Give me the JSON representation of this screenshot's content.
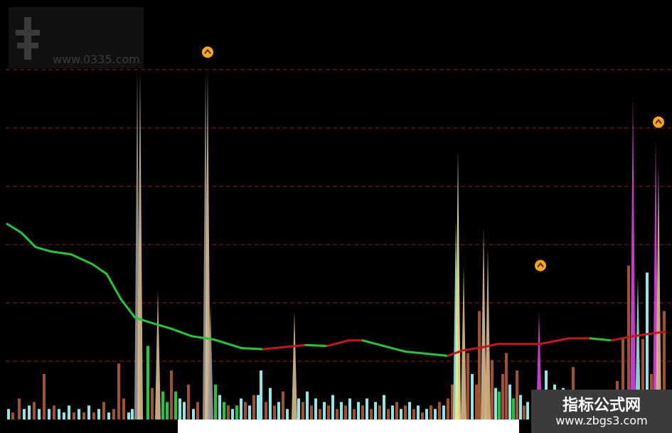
{
  "watermark": {
    "title": "",
    "url": "www.0335.com"
  },
  "brand": {
    "name": "指标公式网",
    "url": "www.zbgs3.com"
  },
  "footer": {
    "text": ""
  },
  "chart_data": {
    "type": "bar",
    "title": "",
    "xlabel": "",
    "ylabel": "",
    "ylim": [
      0,
      100
    ],
    "grid": true,
    "colors": {
      "background": "#000000",
      "grid": "#8b1a1a",
      "line_falling": "#22c83a",
      "line_rising": "#c4161c",
      "arrow": "#f5a623"
    },
    "spikes": [
      {
        "x": 193,
        "value": 100,
        "color": "#9a9a9a"
      },
      {
        "x": 197,
        "value": 100,
        "color": "#d9b98a"
      },
      {
        "x": 222,
        "value": 37,
        "color": "#d9b98a"
      },
      {
        "x": 289,
        "value": 100,
        "color": "#9a9a9a"
      },
      {
        "x": 292,
        "value": 100,
        "color": "#d9b98a"
      },
      {
        "x": 296,
        "value": 33,
        "color": "#9a9a9a"
      },
      {
        "x": 414,
        "value": 31,
        "color": "#d9b98a"
      },
      {
        "x": 641,
        "value": 57,
        "color": "#8fe6e6"
      },
      {
        "x": 644,
        "value": 77,
        "color": "#f0e68c"
      },
      {
        "x": 652,
        "value": 44,
        "color": "#d9b98a"
      },
      {
        "x": 680,
        "value": 55,
        "color": "#d9b98a"
      },
      {
        "x": 686,
        "value": 49,
        "color": "#d9b98a"
      },
      {
        "x": 758,
        "value": 31,
        "color": "#e040e0"
      },
      {
        "x": 890,
        "value": 93,
        "color": "#e040e0"
      },
      {
        "x": 897,
        "value": 41,
        "color": "#8fe6e6"
      },
      {
        "x": 922,
        "value": 80,
        "color": "#e040e0"
      },
      {
        "x": 926,
        "value": 73,
        "color": "#d9b98a"
      }
    ],
    "bars": [
      {
        "x": 12,
        "value": 3,
        "color": "#8fe6e6"
      },
      {
        "x": 18,
        "value": 2,
        "color": "#a0522d"
      },
      {
        "x": 27,
        "value": 6,
        "color": "#a0522d"
      },
      {
        "x": 34,
        "value": 3,
        "color": "#8fe6e6"
      },
      {
        "x": 41,
        "value": 4,
        "color": "#8fe6e6"
      },
      {
        "x": 48,
        "value": 5,
        "color": "#a0522d"
      },
      {
        "x": 55,
        "value": 3,
        "color": "#8fe6e6"
      },
      {
        "x": 62,
        "value": 13,
        "color": "#a0522d"
      },
      {
        "x": 69,
        "value": 3,
        "color": "#8fe6e6"
      },
      {
        "x": 76,
        "value": 4,
        "color": "#a0522d"
      },
      {
        "x": 83,
        "value": 3,
        "color": "#8fe6e6"
      },
      {
        "x": 90,
        "value": 2,
        "color": "#8fe6e6"
      },
      {
        "x": 97,
        "value": 4,
        "color": "#8fe6e6"
      },
      {
        "x": 104,
        "value": 2,
        "color": "#a0522d"
      },
      {
        "x": 111,
        "value": 3,
        "color": "#8fe6e6"
      },
      {
        "x": 118,
        "value": 2,
        "color": "#a0522d"
      },
      {
        "x": 125,
        "value": 4,
        "color": "#8fe6e6"
      },
      {
        "x": 132,
        "value": 2,
        "color": "#a0522d"
      },
      {
        "x": 139,
        "value": 3,
        "color": "#8fe6e6"
      },
      {
        "x": 146,
        "value": 5,
        "color": "#a0522d"
      },
      {
        "x": 153,
        "value": 2,
        "color": "#8fe6e6"
      },
      {
        "x": 160,
        "value": 3,
        "color": "#a0522d"
      },
      {
        "x": 167,
        "value": 16,
        "color": "#a0522d"
      },
      {
        "x": 174,
        "value": 6,
        "color": "#a0522d"
      },
      {
        "x": 181,
        "value": 2,
        "color": "#8fe6e6"
      },
      {
        "x": 186,
        "value": 3,
        "color": "#8fe6e6"
      },
      {
        "x": 208,
        "value": 21,
        "color": "#22c83a"
      },
      {
        "x": 214,
        "value": 9,
        "color": "#a0522d"
      },
      {
        "x": 229,
        "value": 8,
        "color": "#22c83a"
      },
      {
        "x": 235,
        "value": 5,
        "color": "#22c83a"
      },
      {
        "x": 241,
        "value": 14,
        "color": "#a0522d"
      },
      {
        "x": 247,
        "value": 8,
        "color": "#22c83a"
      },
      {
        "x": 253,
        "value": 6,
        "color": "#8fe6e6"
      },
      {
        "x": 259,
        "value": 5,
        "color": "#8fe6e6"
      },
      {
        "x": 265,
        "value": 10,
        "color": "#a0522d"
      },
      {
        "x": 272,
        "value": 3,
        "color": "#8fe6e6"
      },
      {
        "x": 278,
        "value": 5,
        "color": "#a0522d"
      },
      {
        "x": 303,
        "value": 10,
        "color": "#22c83a"
      },
      {
        "x": 309,
        "value": 7,
        "color": "#8fe6e6"
      },
      {
        "x": 315,
        "value": 5,
        "color": "#22c83a"
      },
      {
        "x": 321,
        "value": 4,
        "color": "#a0522d"
      },
      {
        "x": 327,
        "value": 3,
        "color": "#8fe6e6"
      },
      {
        "x": 333,
        "value": 4,
        "color": "#22c83a"
      },
      {
        "x": 339,
        "value": 6,
        "color": "#8fe6e6"
      },
      {
        "x": 345,
        "value": 5,
        "color": "#a0522d"
      },
      {
        "x": 351,
        "value": 4,
        "color": "#8fe6e6"
      },
      {
        "x": 357,
        "value": 7,
        "color": "#a0522d"
      },
      {
        "x": 363,
        "value": 7,
        "color": "#8fe6e6"
      },
      {
        "x": 367,
        "value": 14,
        "color": "#8fe6e6"
      },
      {
        "x": 374,
        "value": 5,
        "color": "#a0522d"
      },
      {
        "x": 380,
        "value": 9,
        "color": "#8fe6e6"
      },
      {
        "x": 386,
        "value": 4,
        "color": "#a0522d"
      },
      {
        "x": 392,
        "value": 5,
        "color": "#8fe6e6"
      },
      {
        "x": 398,
        "value": 8,
        "color": "#a0522d"
      },
      {
        "x": 404,
        "value": 3,
        "color": "#8fe6e6"
      },
      {
        "x": 420,
        "value": 6,
        "color": "#8fe6e6"
      },
      {
        "x": 426,
        "value": 5,
        "color": "#a0522d"
      },
      {
        "x": 432,
        "value": 8,
        "color": "#8fe6e6"
      },
      {
        "x": 438,
        "value": 4,
        "color": "#a0522d"
      },
      {
        "x": 444,
        "value": 6,
        "color": "#8fe6e6"
      },
      {
        "x": 450,
        "value": 3,
        "color": "#a0522d"
      },
      {
        "x": 456,
        "value": 5,
        "color": "#8fe6e6"
      },
      {
        "x": 462,
        "value": 4,
        "color": "#a0522d"
      },
      {
        "x": 468,
        "value": 7,
        "color": "#8fe6e6"
      },
      {
        "x": 474,
        "value": 3,
        "color": "#a0522d"
      },
      {
        "x": 480,
        "value": 5,
        "color": "#8fe6e6"
      },
      {
        "x": 486,
        "value": 4,
        "color": "#a0522d"
      },
      {
        "x": 492,
        "value": 6,
        "color": "#8fe6e6"
      },
      {
        "x": 498,
        "value": 3,
        "color": "#a0522d"
      },
      {
        "x": 504,
        "value": 5,
        "color": "#8fe6e6"
      },
      {
        "x": 510,
        "value": 4,
        "color": "#a0522d"
      },
      {
        "x": 516,
        "value": 6,
        "color": "#8fe6e6"
      },
      {
        "x": 522,
        "value": 3,
        "color": "#a0522d"
      },
      {
        "x": 528,
        "value": 5,
        "color": "#8fe6e6"
      },
      {
        "x": 534,
        "value": 4,
        "color": "#a0522d"
      },
      {
        "x": 540,
        "value": 7,
        "color": "#8fe6e6"
      },
      {
        "x": 546,
        "value": 3,
        "color": "#a0522d"
      },
      {
        "x": 552,
        "value": 4,
        "color": "#8fe6e6"
      },
      {
        "x": 558,
        "value": 5,
        "color": "#a0522d"
      },
      {
        "x": 564,
        "value": 3,
        "color": "#8fe6e6"
      },
      {
        "x": 570,
        "value": 4,
        "color": "#a0522d"
      },
      {
        "x": 576,
        "value": 5,
        "color": "#8fe6e6"
      },
      {
        "x": 582,
        "value": 3,
        "color": "#a0522d"
      },
      {
        "x": 588,
        "value": 4,
        "color": "#8fe6e6"
      },
      {
        "x": 594,
        "value": 2,
        "color": "#a0522d"
      },
      {
        "x": 600,
        "value": 3,
        "color": "#8fe6e6"
      },
      {
        "x": 606,
        "value": 4,
        "color": "#a0522d"
      },
      {
        "x": 612,
        "value": 3,
        "color": "#8fe6e6"
      },
      {
        "x": 618,
        "value": 5,
        "color": "#a0522d"
      },
      {
        "x": 624,
        "value": 4,
        "color": "#8fe6e6"
      },
      {
        "x": 630,
        "value": 6,
        "color": "#a0522d"
      },
      {
        "x": 636,
        "value": 10,
        "color": "#a0522d"
      },
      {
        "x": 658,
        "value": 19,
        "color": "#a0522d"
      },
      {
        "x": 664,
        "value": 13,
        "color": "#8fe6e6"
      },
      {
        "x": 670,
        "value": 10,
        "color": "#a0522d"
      },
      {
        "x": 674,
        "value": 31,
        "color": "#a0522d"
      },
      {
        "x": 692,
        "value": 17,
        "color": "#a0522d"
      },
      {
        "x": 697,
        "value": 9,
        "color": "#8fe6e6"
      },
      {
        "x": 702,
        "value": 8,
        "color": "#22c83a"
      },
      {
        "x": 707,
        "value": 13,
        "color": "#a0522d"
      },
      {
        "x": 712,
        "value": 19,
        "color": "#a0522d"
      },
      {
        "x": 717,
        "value": 10,
        "color": "#8fe6e6"
      },
      {
        "x": 722,
        "value": 6,
        "color": "#22c83a"
      },
      {
        "x": 727,
        "value": 14,
        "color": "#a0522d"
      },
      {
        "x": 732,
        "value": 7,
        "color": "#8fe6e6"
      },
      {
        "x": 737,
        "value": 4,
        "color": "#a0522d"
      },
      {
        "x": 742,
        "value": 5,
        "color": "#8fe6e6"
      },
      {
        "x": 768,
        "value": 14,
        "color": "#8fe6e6"
      },
      {
        "x": 774,
        "value": 8,
        "color": "#a0522d"
      },
      {
        "x": 780,
        "value": 10,
        "color": "#8fe6e6"
      },
      {
        "x": 786,
        "value": 6,
        "color": "#a0522d"
      },
      {
        "x": 792,
        "value": 9,
        "color": "#8fe6e6"
      },
      {
        "x": 806,
        "value": 15,
        "color": "#a0522d"
      },
      {
        "x": 868,
        "value": 11,
        "color": "#a0522d"
      },
      {
        "x": 876,
        "value": 23,
        "color": "#a0522d"
      },
      {
        "x": 884,
        "value": 44,
        "color": "#a0522d"
      },
      {
        "x": 904,
        "value": 23,
        "color": "#a0522d"
      },
      {
        "x": 910,
        "value": 42,
        "color": "#8fe6e6"
      },
      {
        "x": 916,
        "value": 13,
        "color": "#a0522d"
      },
      {
        "x": 934,
        "value": 31,
        "color": "#a0522d"
      }
    ],
    "line": [
      {
        "x": 10,
        "value": 55.9
      },
      {
        "x": 30,
        "value": 53.4
      },
      {
        "x": 50,
        "value": 49.3
      },
      {
        "x": 70,
        "value": 48.1
      },
      {
        "x": 100,
        "value": 47.2
      },
      {
        "x": 130,
        "value": 44.4
      },
      {
        "x": 150,
        "value": 41.6
      },
      {
        "x": 170,
        "value": 34.4
      },
      {
        "x": 190,
        "value": 29.1
      },
      {
        "x": 210,
        "value": 27.8
      },
      {
        "x": 240,
        "value": 26.0
      },
      {
        "x": 270,
        "value": 23.8
      },
      {
        "x": 300,
        "value": 22.9
      },
      {
        "x": 340,
        "value": 20.4
      },
      {
        "x": 370,
        "value": 20.1
      },
      {
        "x": 400,
        "value": 20.7
      },
      {
        "x": 430,
        "value": 21.3
      },
      {
        "x": 460,
        "value": 21.0
      },
      {
        "x": 490,
        "value": 22.6
      },
      {
        "x": 510,
        "value": 22.6
      },
      {
        "x": 540,
        "value": 21.0
      },
      {
        "x": 570,
        "value": 19.4
      },
      {
        "x": 600,
        "value": 18.8
      },
      {
        "x": 630,
        "value": 18.2
      },
      {
        "x": 650,
        "value": 19.7
      },
      {
        "x": 680,
        "value": 20.7
      },
      {
        "x": 700,
        "value": 21.6
      },
      {
        "x": 730,
        "value": 21.6
      },
      {
        "x": 760,
        "value": 21.6
      },
      {
        "x": 800,
        "value": 23.2
      },
      {
        "x": 830,
        "value": 23.2
      },
      {
        "x": 860,
        "value": 22.6
      },
      {
        "x": 890,
        "value": 23.8
      },
      {
        "x": 935,
        "value": 25.1
      }
    ],
    "signals": [
      {
        "x": 292,
        "value": 105
      },
      {
        "x": 760,
        "value": 44
      },
      {
        "x": 926,
        "value": 85
      }
    ]
  }
}
